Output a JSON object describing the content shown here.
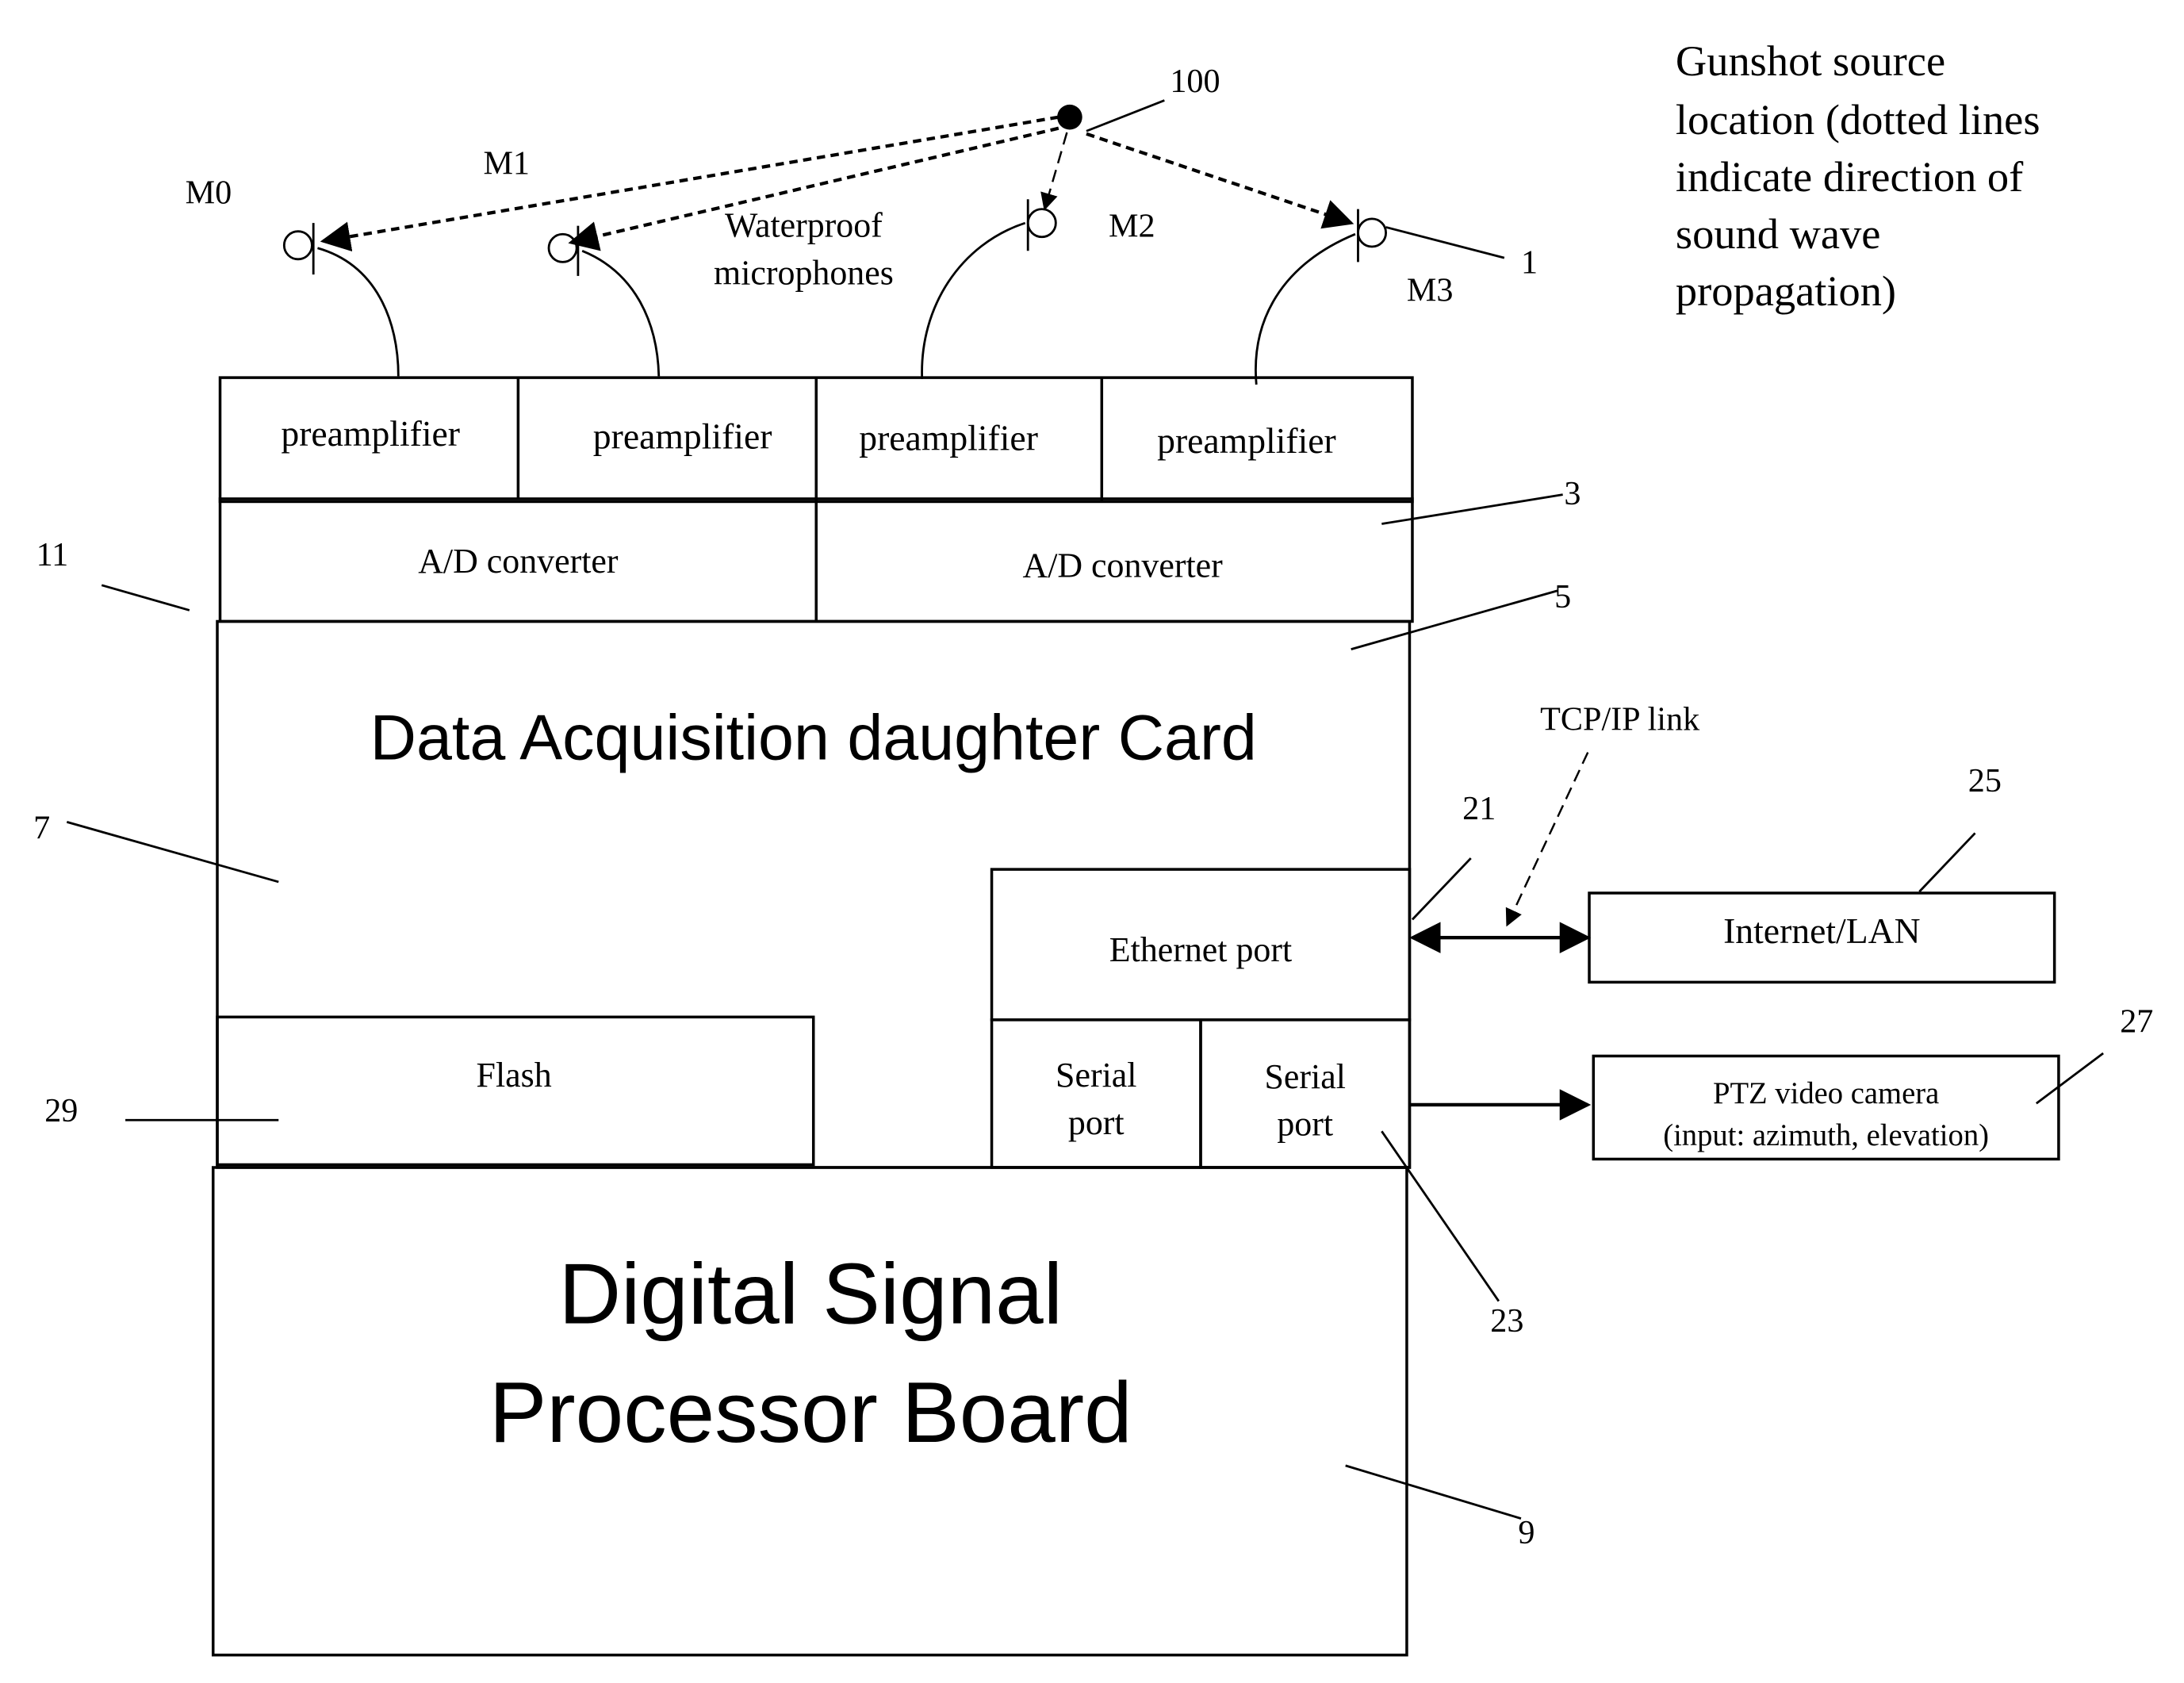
{
  "diagram": {
    "source": {
      "label": "100"
    },
    "note": {
      "lines": [
        "Gunshot source",
        "location (dotted lines",
        "indicate direction of",
        "sound wave",
        "propagation)"
      ]
    },
    "microphones": {
      "caption_line1": "Waterproof",
      "caption_line2": "microphones",
      "items": [
        {
          "label": "M0"
        },
        {
          "label": "M1"
        },
        {
          "label": "M2"
        },
        {
          "label": "M3"
        }
      ],
      "ref": "1"
    },
    "preamplifiers": [
      "preamplifier",
      "preamplifier",
      "preamplifier",
      "preamplifier"
    ],
    "ad_converters": [
      "A/D converter",
      "A/D converter"
    ],
    "daq_card": {
      "title": "Data Acquisition daughter Card"
    },
    "ethernet_port": "Ethernet port",
    "serial_ports": [
      {
        "line1": "Serial",
        "line2": "port"
      },
      {
        "line1": "Serial",
        "line2": "port"
      }
    ],
    "flash": "Flash",
    "dsp_board": {
      "line1": "Digital Signal",
      "line2": "Processor Board"
    },
    "tcpip_label": "TCP/IP link",
    "internet_lan": "Internet/LAN",
    "ptz_camera": {
      "line1": "PTZ video camera",
      "line2": "(input: azimuth, elevation)"
    },
    "refs": {
      "r3": "3",
      "r5": "5",
      "r7": "7",
      "r9": "9",
      "r11": "11",
      "r21": "21",
      "r23": "23",
      "r25": "25",
      "r27": "27",
      "r29": "29"
    }
  }
}
